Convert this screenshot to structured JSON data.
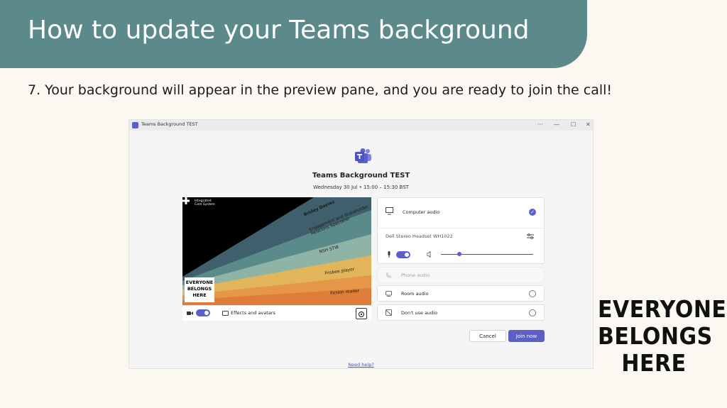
{
  "slide": {
    "title": "How to update your Teams background",
    "step": "7. Your background will appear in the preview pane, and you are ready to join the call!",
    "brand_lines": [
      "EVERYONE",
      "BELONGS",
      "HERE"
    ]
  },
  "window": {
    "title": "Teams Background TEST",
    "controls": [
      "···",
      "—",
      "☐",
      "✕"
    ]
  },
  "meeting": {
    "title": "Teams Background TEST",
    "time": "Wednesday 30 Jul  •  15:00  –  15:30 BST"
  },
  "preview": {
    "org_name": "Integrated\nCare System",
    "badge_lines": [
      "EVERYONE",
      "BELONGS",
      "HERE"
    ],
    "stripes": [
      "Bridey Davies",
      "Engagement and Stakeholder\nRelations Specialist",
      "NSH STW",
      "Frisbee player",
      "Fiction reader"
    ]
  },
  "video_bar": {
    "effects_label": "Effects and avatars"
  },
  "audio": {
    "computer_audio": "Computer audio",
    "device": "Dell Stereo Headset WH1022",
    "phone_audio": "Phone audio",
    "room_audio": "Room audio",
    "no_audio": "Don't use audio",
    "volume_level": 0.2
  },
  "buttons": {
    "cancel": "Cancel",
    "join": "Join now"
  },
  "help": "Need help?",
  "colors": {
    "banner": "#5c8a8a",
    "teams_accent": "#5b5fc7"
  }
}
